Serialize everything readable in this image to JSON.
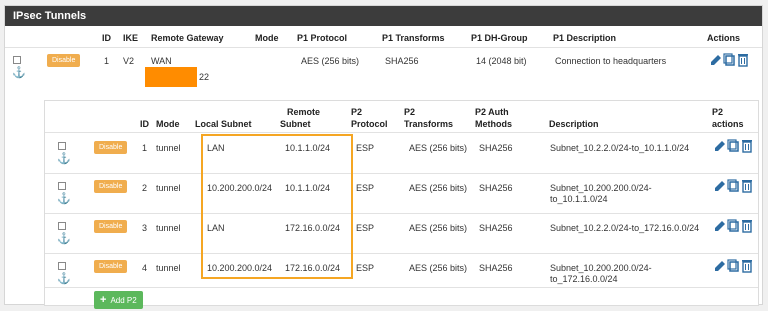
{
  "panel": {
    "title": "IPsec Tunnels"
  },
  "p1": {
    "headers": {
      "id": "ID",
      "ike": "IKE",
      "gateway": "Remote Gateway",
      "mode": "Mode",
      "protocol": "P1 Protocol",
      "transforms": "P1 Transforms",
      "dhgroup": "P1 DH-Group",
      "description": "P1 Description",
      "actions": "Actions"
    },
    "row": {
      "disable": "Disable",
      "id": "1",
      "ike": "V2",
      "gateway": "WAN",
      "gateway_port": "22",
      "protocol": "AES (256 bits)",
      "transforms": "SHA256",
      "dhgroup": "14 (2048 bit)",
      "description": "Connection to headquarters"
    }
  },
  "p2": {
    "headers": {
      "id": "ID",
      "mode": "Mode",
      "local": "Local Subnet",
      "remote_1": "Remote",
      "remote_2": "Subnet",
      "protocol_1": "P2",
      "protocol_2": "Protocol",
      "transforms_1": "P2",
      "transforms_2": "Transforms",
      "auth_1": "P2 Auth",
      "auth_2": "Methods",
      "description": "Description",
      "actions_1": "P2",
      "actions_2": "actions"
    },
    "rows": [
      {
        "disable": "Disable",
        "id": "1",
        "mode": "tunnel",
        "local": "LAN",
        "remote": "10.1.1.0/24",
        "protocol": "ESP",
        "transforms": "AES (256 bits)",
        "auth": "SHA256",
        "desc_1": "Subnet_10.2.2.0/24-to_10.1.1.0/24",
        "desc_2": ""
      },
      {
        "disable": "Disable",
        "id": "2",
        "mode": "tunnel",
        "local": "10.200.200.0/24",
        "remote": "10.1.1.0/24",
        "protocol": "ESP",
        "transforms": "AES (256 bits)",
        "auth": "SHA256",
        "desc_1": "Subnet_10.200.200.0/24-",
        "desc_2": "to_10.1.1.0/24"
      },
      {
        "disable": "Disable",
        "id": "3",
        "mode": "tunnel",
        "local": "LAN",
        "remote": "172.16.0.0/24",
        "protocol": "ESP",
        "transforms": "AES (256 bits)",
        "auth": "SHA256",
        "desc_1": "Subnet_10.2.2.0/24-to_172.16.0.0/24",
        "desc_2": ""
      },
      {
        "disable": "Disable",
        "id": "4",
        "mode": "tunnel",
        "local": "10.200.200.0/24",
        "remote": "172.16.0.0/24",
        "protocol": "ESP",
        "transforms": "AES (256 bits)",
        "auth": "SHA256",
        "desc_1": "Subnet_10.200.200.0/24-",
        "desc_2": "to_172.16.0.0/24"
      }
    ],
    "add_label": "Add P2"
  },
  "colors": {
    "header_bg": "#3c3c3c",
    "disable_btn": "#f0ad4e",
    "accent_blue": "#2d6ca2",
    "highlight": "#f5a623",
    "redaction": "#ff8c00",
    "add_btn": "#5cb85c"
  },
  "icons": {
    "edit": "pencil-icon",
    "copy": "copy-icon",
    "delete": "trash-icon",
    "anchor": "anchor-icon",
    "add": "plus-icon"
  }
}
